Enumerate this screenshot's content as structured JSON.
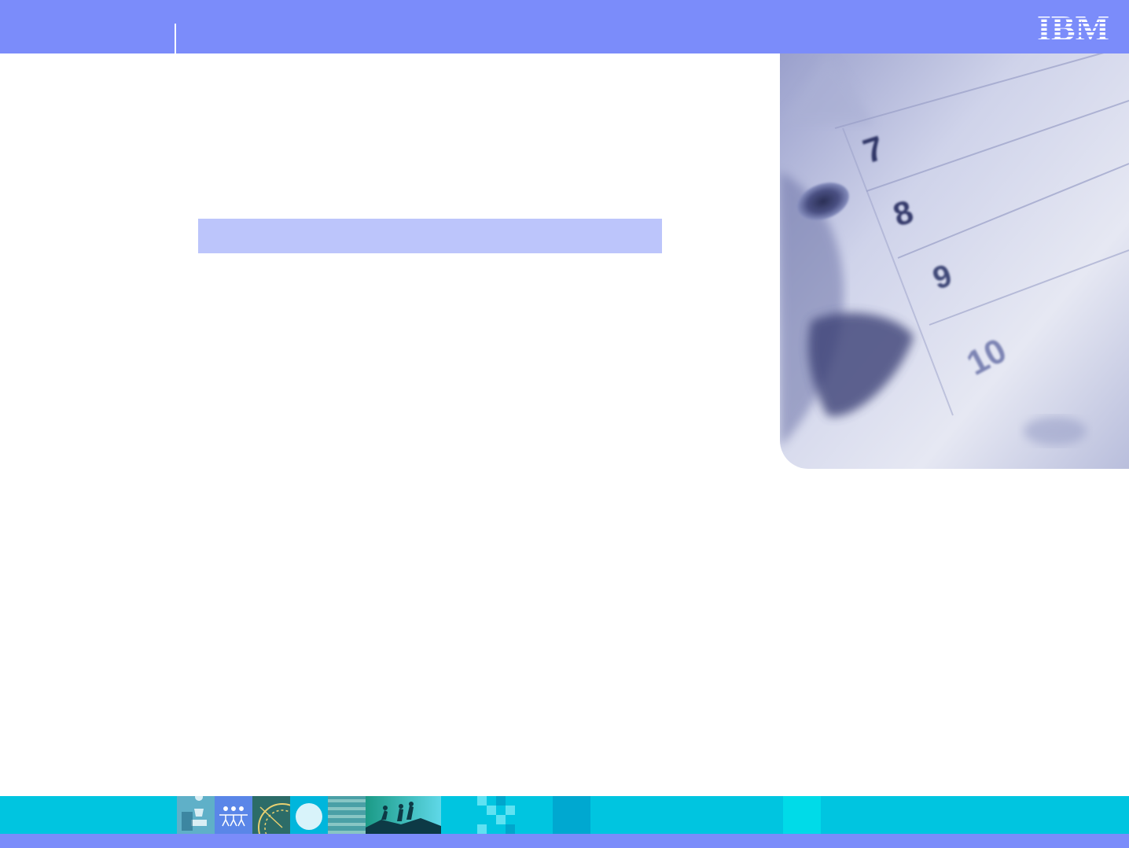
{
  "header": {
    "logo_text": "IBM",
    "bar_color": "#7b8cfa"
  },
  "slide": {
    "title_placeholder_color": "#bcc5fb"
  },
  "photo": {
    "calendar_numbers": [
      "7",
      "8",
      "9",
      "10"
    ]
  },
  "footer": {
    "strip_color": "#00c5e0",
    "bar_color": "#7b8cfa"
  }
}
